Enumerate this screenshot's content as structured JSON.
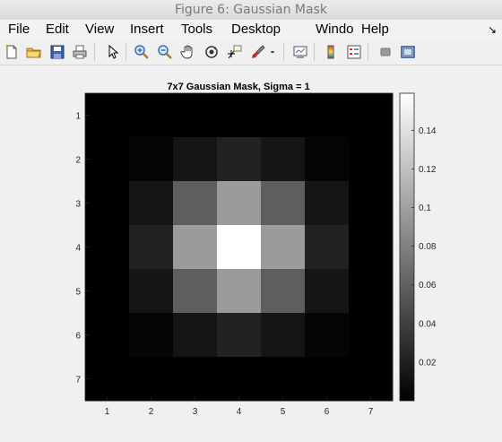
{
  "window": {
    "title": "Figure 6: Gaussian Mask"
  },
  "menu": {
    "items": [
      "File",
      "Edit",
      "View",
      "Insert",
      "Tools",
      "Desktop",
      "Windo",
      "Help"
    ],
    "overflow_icon": "chevron-right-down-icon"
  },
  "toolbar": {
    "icons": [
      "new-figure-icon",
      "open-file-icon",
      "save-icon",
      "print-icon",
      "pointer-icon",
      "zoom-in-icon",
      "zoom-out-icon",
      "pan-hand-icon",
      "rotate-3d-icon",
      "data-cursor-icon",
      "brush-icon",
      "brush-dropdown-icon",
      "link-plot-icon",
      "colorbar-icon",
      "legend-icon",
      "hide-plot-tools-icon",
      "show-plot-tools-icon"
    ]
  },
  "chart_data": {
    "type": "heatmap",
    "title": "7x7 Gaussian Mask, Sigma = 1",
    "x_ticks": [
      "1",
      "2",
      "3",
      "4",
      "5",
      "6",
      "7"
    ],
    "y_ticks": [
      "1",
      "2",
      "3",
      "4",
      "5",
      "6",
      "7"
    ],
    "colormap": "gray",
    "clim": [
      0,
      0.1592
    ],
    "colorbar_ticks": [
      "0.02",
      "0.04",
      "0.06",
      "0.08",
      "0.1",
      "0.12",
      "0.14"
    ],
    "colorbar_tick_values": [
      0.02,
      0.04,
      0.06,
      0.08,
      0.1,
      0.12,
      0.14
    ],
    "values": [
      [
        0.0,
        0.0,
        0.0,
        0.0,
        0.0,
        0.0,
        0.0
      ],
      [
        0.0,
        0.003,
        0.0131,
        0.0215,
        0.0131,
        0.003,
        0.0
      ],
      [
        0.0,
        0.0131,
        0.0585,
        0.0965,
        0.0585,
        0.0131,
        0.0
      ],
      [
        0.0,
        0.0215,
        0.0965,
        0.1592,
        0.0965,
        0.0215,
        0.0
      ],
      [
        0.0,
        0.0131,
        0.0585,
        0.0965,
        0.0585,
        0.0131,
        0.0
      ],
      [
        0.0,
        0.003,
        0.0131,
        0.0215,
        0.0131,
        0.003,
        0.0
      ],
      [
        0.0,
        0.0,
        0.0,
        0.0,
        0.0,
        0.0,
        0.0
      ]
    ]
  }
}
